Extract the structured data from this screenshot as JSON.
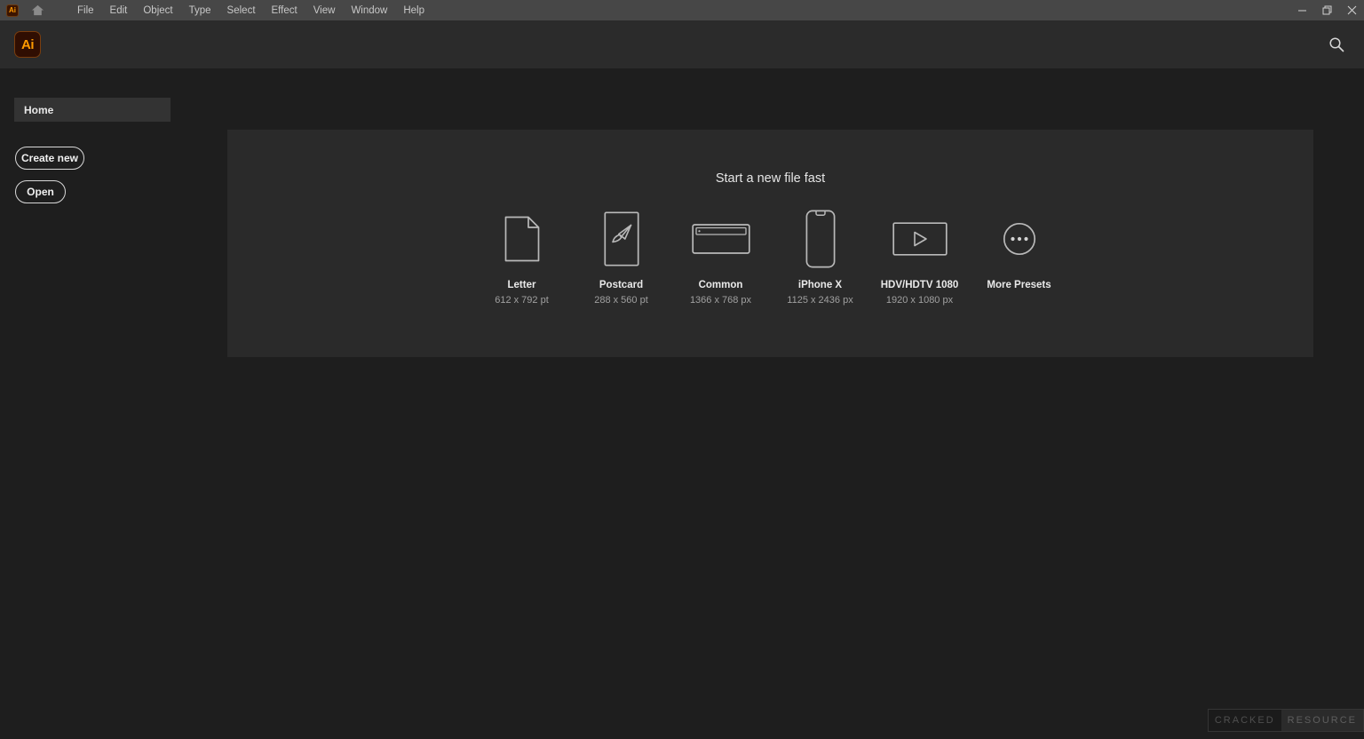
{
  "titlebar": {
    "app_badge": "Ai",
    "home_icon": "home-icon",
    "menus": [
      {
        "label": "File"
      },
      {
        "label": "Edit"
      },
      {
        "label": "Object"
      },
      {
        "label": "Type"
      },
      {
        "label": "Select"
      },
      {
        "label": "Effect"
      },
      {
        "label": "View"
      },
      {
        "label": "Window"
      },
      {
        "label": "Help"
      }
    ],
    "window_controls": {
      "minimize": "–",
      "restore": "❐",
      "close": "✕"
    }
  },
  "header": {
    "app_badge": "Ai",
    "search_icon": "search-icon"
  },
  "sidebar": {
    "items": [
      {
        "label": "Home"
      }
    ],
    "buttons": [
      {
        "label": "Create new"
      },
      {
        "label": "Open"
      }
    ]
  },
  "main": {
    "title": "Start a new file fast",
    "presets": [
      {
        "label": "Letter",
        "size": "612 x 792 pt",
        "icon": "document-icon"
      },
      {
        "label": "Postcard",
        "size": "288 x 560 pt",
        "icon": "paintbrush-icon"
      },
      {
        "label": "Common",
        "size": "1366 x 768 px",
        "icon": "browser-window-icon"
      },
      {
        "label": "iPhone X",
        "size": "1125 x 2436 px",
        "icon": "phone-icon"
      },
      {
        "label": "HDV/HDTV 1080",
        "size": "1920 x 1080 px",
        "icon": "video-play-icon"
      },
      {
        "label": "More Presets",
        "size": "",
        "icon": "ellipsis-circle-icon"
      }
    ]
  },
  "watermark": {
    "part_one": "CRACKED",
    "part_two": "RESOURCE"
  },
  "colors": {
    "titlebar_bg": "#474747",
    "header_bg": "#2b2b2b",
    "page_bg": "#1e1e1e",
    "panel_bg": "#2a2a2a",
    "nav_active_bg": "#333333",
    "brand_orange": "#ff9a00",
    "icon_stroke": "#b9b9b9"
  }
}
